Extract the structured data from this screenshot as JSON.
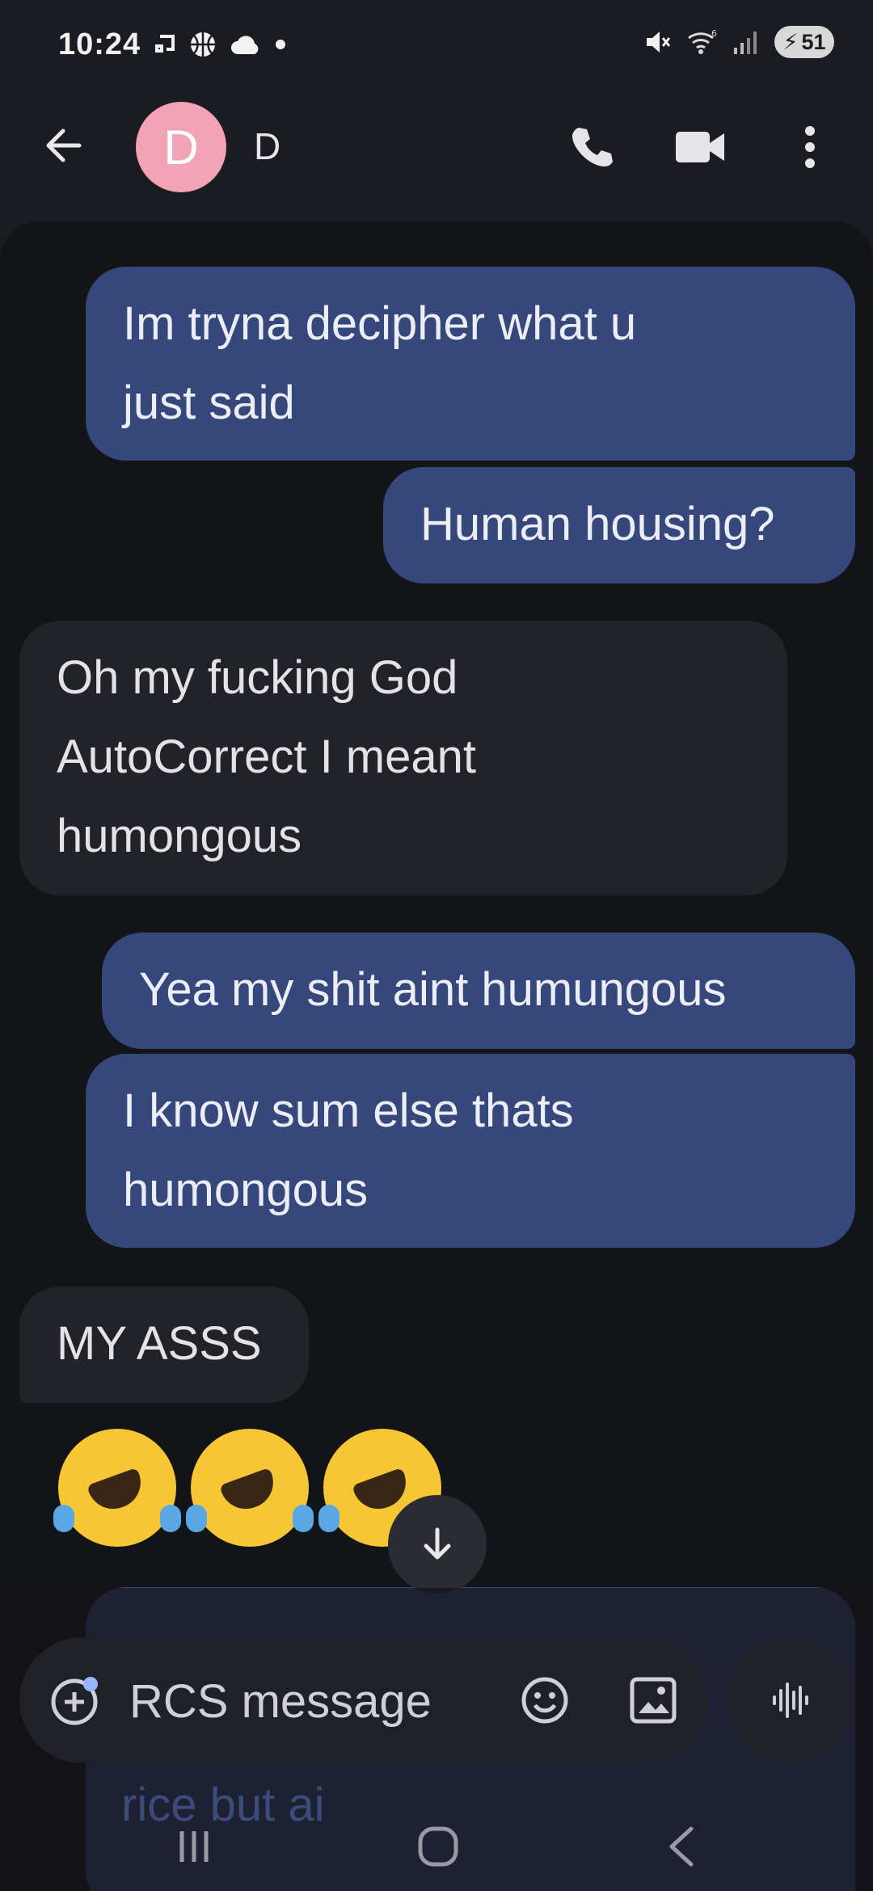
{
  "status": {
    "time": "10:24",
    "battery": "51",
    "icons_left": [
      "cast-icon",
      "basketball-icon",
      "cloud-icon",
      "dot-icon"
    ],
    "icons_right": [
      "mute-icon",
      "wifi-icon",
      "signal-icon",
      "battery-icon"
    ]
  },
  "header": {
    "avatar_letter": "D",
    "contact_name": "D",
    "avatar_color": "#f2a4b6"
  },
  "messages": [
    {
      "dir": "out",
      "lines": [
        "Im tryna decipher what u",
        "just said"
      ]
    },
    {
      "dir": "out",
      "lines": [
        "Human housing?"
      ]
    },
    {
      "dir": "in",
      "lines": [
        "Oh my fucking God",
        "AutoCorrect I meant",
        "humongous"
      ]
    },
    {
      "dir": "out",
      "lines": [
        "Yea my shit aint humungous"
      ]
    },
    {
      "dir": "out",
      "lines": [
        "I know sum else thats",
        "humongous"
      ]
    },
    {
      "dir": "in",
      "lines": [
        "MY ASSS"
      ]
    },
    {
      "dir": "in",
      "emoji": "rolling-on-floor-laughing x3"
    }
  ],
  "partial_message": {
    "visible_text": "rice but ai"
  },
  "composer": {
    "placeholder": "RCS message"
  },
  "colors": {
    "outgoing": "#36477b",
    "incoming": "#222329",
    "background": "#131418"
  }
}
